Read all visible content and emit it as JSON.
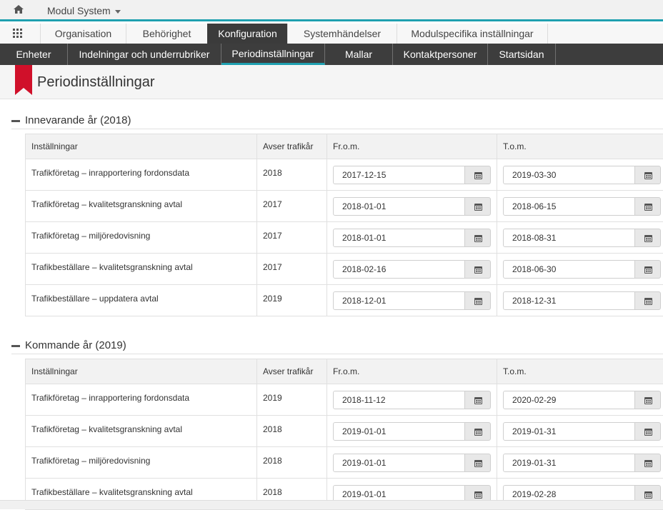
{
  "topbar": {
    "module_label": "Modul System"
  },
  "tabs": [
    "Organisation",
    "Behörighet",
    "Konfiguration",
    "Systemhändelser",
    "Modulspecifika inställningar"
  ],
  "subtabs": [
    "Enheter",
    "Indelningar och underrubriker",
    "Periodinställningar",
    "Mallar",
    "Kontaktpersoner",
    "Startsidan"
  ],
  "page": {
    "title": "Periodinställningar"
  },
  "columns": {
    "settings": "Inställningar",
    "year": "Avser trafikår",
    "from": "Fr.o.m.",
    "to": "T.o.m."
  },
  "current": {
    "title": "Innevarande år (2018)",
    "rows": [
      {
        "name": "Trafikföretag – inrapportering fordonsdata",
        "year": "2018",
        "from": "2017-12-15",
        "to": "2019-03-30"
      },
      {
        "name": "Trafikföretag – kvalitetsgranskning avtal",
        "year": "2017",
        "from": "2018-01-01",
        "to": "2018-06-15"
      },
      {
        "name": "Trafikföretag – miljöredovisning",
        "year": "2017",
        "from": "2018-01-01",
        "to": "2018-08-31"
      },
      {
        "name": "Trafikbeställare – kvalitetsgranskning avtal",
        "year": "2017",
        "from": "2018-02-16",
        "to": "2018-06-30"
      },
      {
        "name": "Trafikbeställare – uppdatera avtal",
        "year": "2019",
        "from": "2018-12-01",
        "to": "2018-12-31"
      }
    ]
  },
  "next": {
    "title": "Kommande år (2019)",
    "rows": [
      {
        "name": "Trafikföretag – inrapportering fordonsdata",
        "year": "2019",
        "from": "2018-11-12",
        "to": "2020-02-29"
      },
      {
        "name": "Trafikföretag – kvalitetsgranskning avtal",
        "year": "2018",
        "from": "2019-01-01",
        "to": "2019-01-31"
      },
      {
        "name": "Trafikföretag – miljöredovisning",
        "year": "2018",
        "from": "2019-01-01",
        "to": "2019-01-31"
      },
      {
        "name": "Trafikbeställare – kvalitetsgranskning avtal",
        "year": "2018",
        "from": "2019-01-01",
        "to": "2019-02-28"
      }
    ]
  },
  "colors": {
    "accent": "#1fa0b0",
    "ribbon": "#d0102a",
    "active_tab": "#3b3b3b"
  },
  "icons": {
    "home": "home-icon",
    "apps": "grid-icon",
    "calendar": "calendar-icon"
  }
}
